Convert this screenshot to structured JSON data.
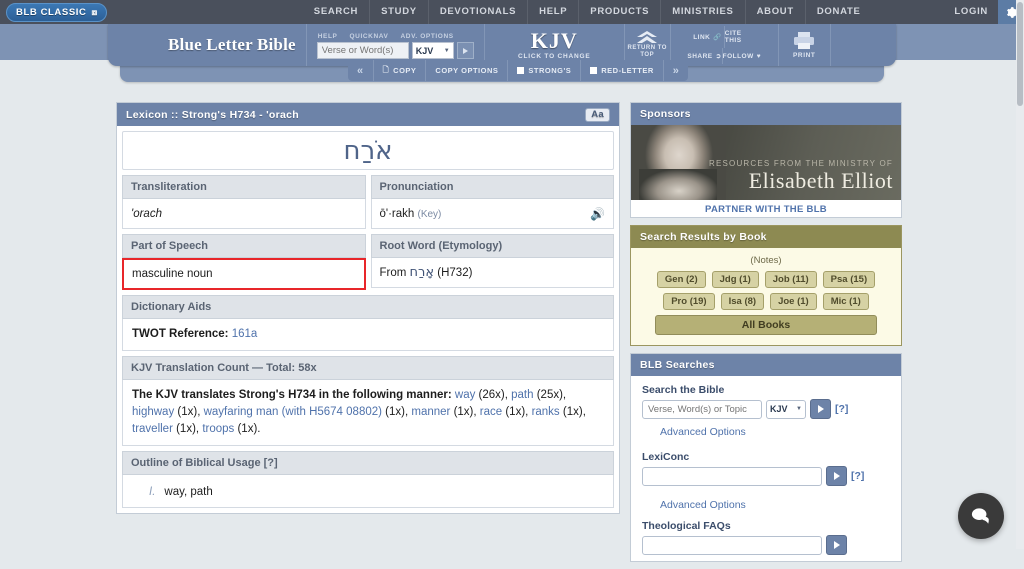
{
  "topbar": {
    "classic_label": "BLB CLASSIC",
    "classic_icon": "external-link-icon",
    "nav": [
      "SEARCH",
      "STUDY",
      "DEVOTIONALS",
      "HELP",
      "PRODUCTS",
      "MINISTRIES",
      "ABOUT",
      "DONATE"
    ],
    "login": "LOGIN",
    "gear_icon": "gear-icon"
  },
  "header": {
    "site_title": "Blue Letter Bible",
    "quick_links": [
      "HELP",
      "QUICKNAV",
      "ADV. OPTIONS"
    ],
    "search_placeholder": "Verse or Word(s)",
    "search_value": "",
    "version": "KJV",
    "go_icon": "play-arrow-icon",
    "version_big": "KJV",
    "version_sub": "CLICK TO CHANGE",
    "return_to_top": "RETURN TO TOP",
    "tools": [
      "LINK",
      "CITE THIS",
      "SHARE",
      "FOLLOW"
    ],
    "print": "PRINT"
  },
  "copybar": {
    "prev_icon": "double-chevron-left-icon",
    "next_icon": "double-chevron-right-icon",
    "items": [
      "COPY",
      "COPY OPTIONS",
      "STRONG'S",
      "RED-LETTER"
    ]
  },
  "lexicon": {
    "panel_title": "Lexicon :: Strong's H734 - 'orach",
    "font_button": "Aa",
    "hebrew_word": "אֹרַח",
    "transliteration_label": "Transliteration",
    "transliteration_value": "'orach",
    "pronunciation_label": "Pronunciation",
    "pronunciation_value": "ō'·rakh",
    "pronunciation_key": "(Key)",
    "speaker_icon": "speaker-icon",
    "part_of_speech_label": "Part of Speech",
    "part_of_speech_value": "masculine noun",
    "root_word_label": "Root Word (Etymology)",
    "root_word_from": "From",
    "root_word_hebrew": "אָרַח",
    "root_word_ref": "(H732)",
    "dictionary_aids_label": "Dictionary Aids",
    "twot_label": "TWOT Reference:",
    "twot_value": "161a",
    "kjv_count_label": "KJV Translation Count — Total: 58x",
    "kjv_intro": "The KJV translates Strong's H734 in the following manner:",
    "kjv_terms": [
      {
        "term": "way",
        "count": "(26x),"
      },
      {
        "term": "path",
        "count": "(25x),"
      },
      {
        "term": "highway",
        "count": "(1x),"
      },
      {
        "term": "wayfaring man (with H5674 08802)",
        "count": "(1x),"
      },
      {
        "term": "manner",
        "count": "(1x),"
      },
      {
        "term": "race",
        "count": "(1x),"
      },
      {
        "term": "ranks",
        "count": "(1x),"
      },
      {
        "term": "traveller",
        "count": "(1x),"
      },
      {
        "term": "troops",
        "count": "(1x)."
      }
    ],
    "outline_label": "Outline of Biblical Usage [?]",
    "outline_items": [
      {
        "num": "I.",
        "text": "way, path"
      }
    ]
  },
  "sidebar": {
    "sponsors_title": "Sponsors",
    "ad_small": "RESOURCES FROM THE MINISTRY OF",
    "ad_name": "Elisabeth Elliot",
    "ad_partner": "PARTNER WITH THE BLB",
    "srb_title": "Search Results by Book",
    "notes": "(Notes)",
    "book_chips": [
      [
        "Gen (2)",
        "Jdg (1)",
        "Job (11)",
        "Psa (15)"
      ],
      [
        "Pro (19)",
        "Isa (8)",
        "Joe (1)",
        "Mic (1)"
      ]
    ],
    "all_books": "All Books",
    "searches_title": "BLB Searches",
    "search_bible_label": "Search the Bible",
    "search_bible_placeholder": "Verse, Word(s) or Topic",
    "search_bible_version": "KJV",
    "help_marker": "[?]",
    "advanced_options": "Advanced Options",
    "lexiconc_label": "LexiConc",
    "lexiconc_placeholder": "",
    "theological_faqs_label": "Theological FAQs"
  },
  "chat": {
    "icon": "chat-bubble-icon"
  },
  "colors": {
    "accent_blue": "#6d83a8",
    "highlight_red": "#e8262a",
    "olive": "#8d8a52",
    "link_blue": "#4f72ab"
  }
}
